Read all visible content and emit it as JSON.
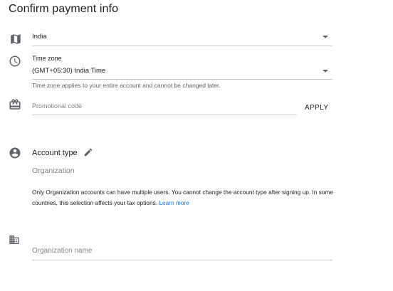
{
  "page": {
    "title": "Confirm payment info"
  },
  "country": {
    "icon": "map-icon",
    "value": "India"
  },
  "timezone": {
    "icon": "clock-icon",
    "label": "Time zone",
    "value": "(GMT+05:30) India Time",
    "helper": "Time zone applies to your entire account and cannot be changed later."
  },
  "promo": {
    "icon": "gift-card-icon",
    "placeholder": "Promotional code",
    "apply_label": "APPLY"
  },
  "account_type": {
    "icon": "account-circle-icon",
    "edit_icon": "pencil-icon",
    "label": "Account type",
    "value": "Organization",
    "info": "Only Organization accounts can have multiple users. You cannot change the account type after signing up. In some countries, this selection affects your tax options.",
    "learn_more": "Learn more"
  },
  "organization": {
    "icon": "building-icon",
    "placeholder": "Organization name"
  },
  "colors": {
    "link": "#1a73e8",
    "icon": "#5f6368",
    "divider": "#c9c9c9"
  }
}
